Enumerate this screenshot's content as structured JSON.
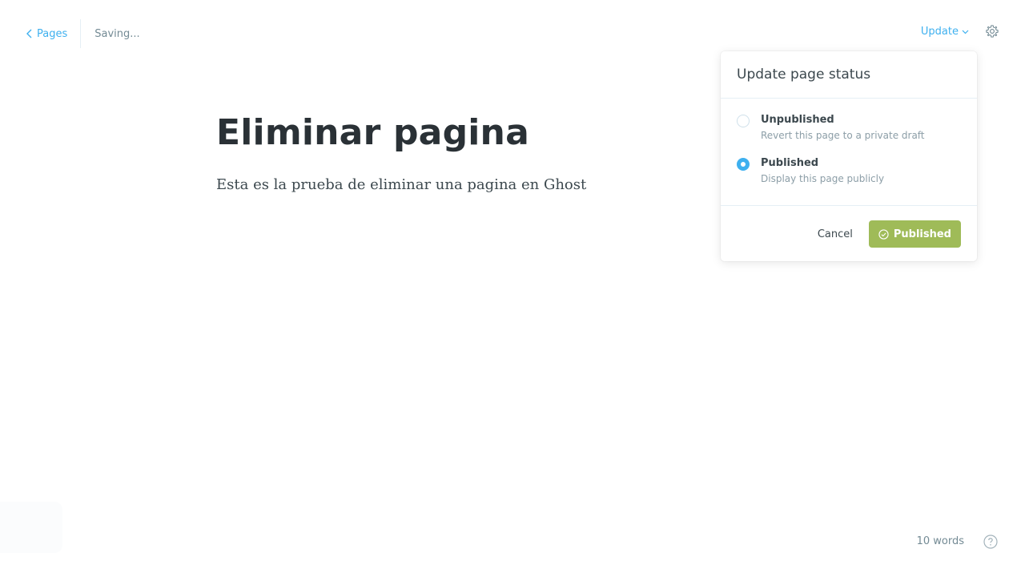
{
  "header": {
    "back_label": "Pages",
    "save_status": "Saving...",
    "update_label": "Update"
  },
  "editor": {
    "title": "Eliminar pagina",
    "body": "Esta es la prueba de eliminar una pagina en Ghost"
  },
  "status_dropdown": {
    "heading": "Update page status",
    "options": [
      {
        "label": "Unpublished",
        "description": "Revert this page to a private draft",
        "selected": false
      },
      {
        "label": "Published",
        "description": "Display this page publicly",
        "selected": true
      }
    ],
    "cancel_label": "Cancel",
    "confirm_label": "Published"
  },
  "footer": {
    "word_count": "10 words"
  },
  "icons": {
    "back": "chevron-left-icon",
    "update_caret": "chevron-down-icon",
    "settings": "gear-icon",
    "confirm": "check-circle-icon",
    "help": "help-circle-icon"
  },
  "colors": {
    "accent": "#3eb0ef",
    "publish_green": "#9fbb58",
    "title_text": "#2a3136",
    "muted_text": "#738a94"
  }
}
